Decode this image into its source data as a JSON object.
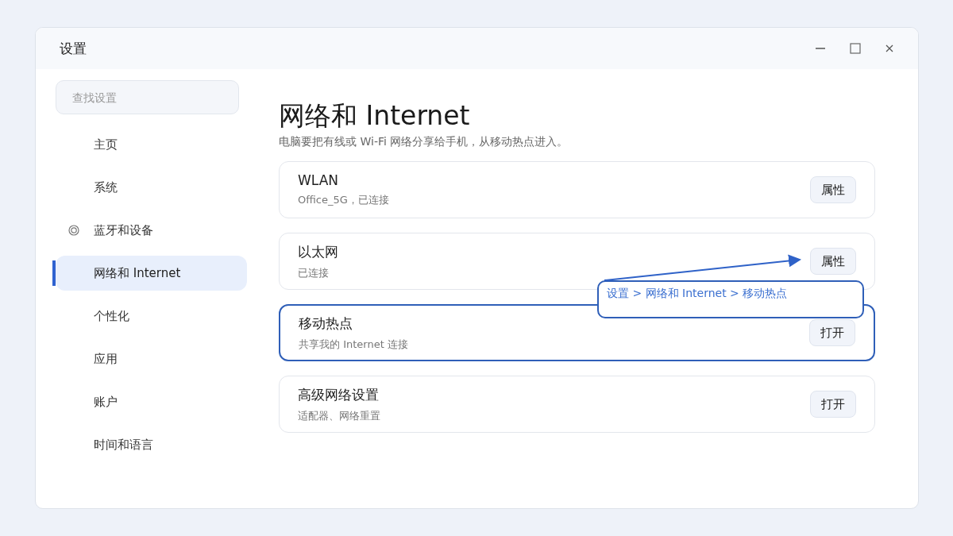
{
  "window": {
    "title": "设置"
  },
  "search": {
    "placeholder": "查找设置"
  },
  "sidebar": {
    "items": [
      {
        "label": "主页",
        "selected": false,
        "has_icon": false
      },
      {
        "label": "系统",
        "selected": false,
        "has_icon": false
      },
      {
        "label": "蓝牙和设备",
        "selected": false,
        "has_icon": true
      },
      {
        "label": "网络和 Internet",
        "selected": true,
        "has_icon": false
      },
      {
        "label": "个性化",
        "selected": false,
        "has_icon": false
      },
      {
        "label": "应用",
        "selected": false,
        "has_icon": false
      },
      {
        "label": "账户",
        "selected": false,
        "has_icon": false
      },
      {
        "label": "时间和语言",
        "selected": false,
        "has_icon": false
      }
    ]
  },
  "page": {
    "title": "网络和 Internet",
    "subtitle": "电脑要把有线或 Wi‑Fi 网络分享给手机，从移动热点进入。"
  },
  "cards": [
    {
      "title": "WLAN",
      "subtitle": "Office_5G，已连接",
      "button": "属性",
      "highlighted": false
    },
    {
      "title": "以太网",
      "subtitle": "已连接",
      "button": "属性",
      "highlighted": false
    },
    {
      "title": "移动热点",
      "subtitle": "共享我的 Internet 连接",
      "button": "打开",
      "highlighted": true
    },
    {
      "title": "高级网络设置",
      "subtitle": "适配器、网络重置",
      "button": "打开",
      "highlighted": false
    }
  ],
  "annotation": {
    "callout": "设置 > 网络和 Internet > 移动热点"
  }
}
